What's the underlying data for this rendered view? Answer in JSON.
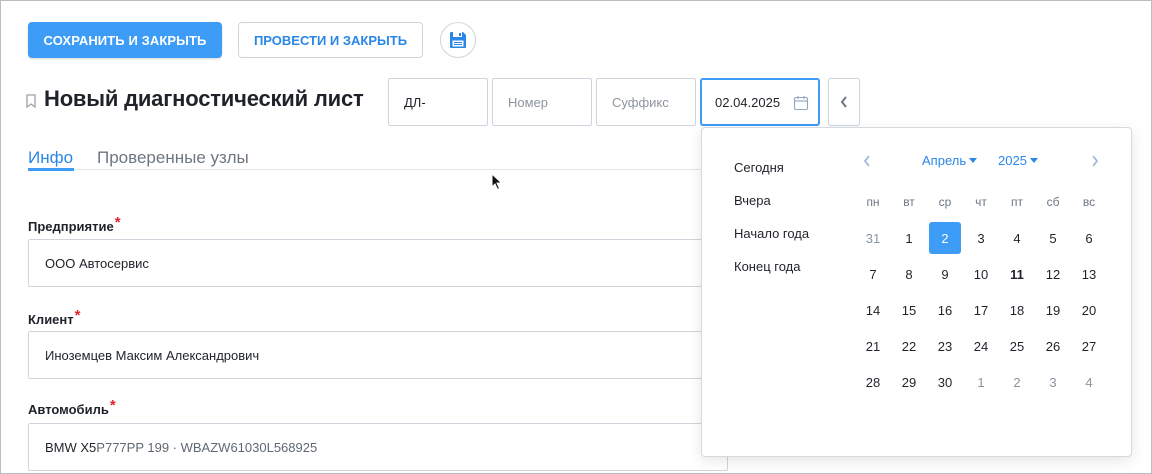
{
  "toolbar": {
    "save_close_label": "СОХРАНИТЬ И ЗАКРЫТЬ",
    "post_close_label": "ПРОВЕСТИ И ЗАКРЫТЬ",
    "save_icon": "floppy-disk-icon"
  },
  "header": {
    "title": "Новый диагностический лист",
    "prefix_value": "ДЛ-",
    "number_placeholder": "Номер",
    "suffix_placeholder": "Суффикс",
    "date_value": "02.04.2025"
  },
  "tabs": [
    {
      "label": "Инфо",
      "active": true
    },
    {
      "label": "Проверенные узлы",
      "active": false
    }
  ],
  "form": {
    "company_label": "Предприятие",
    "company_value": "ООО Автосервис",
    "client_label": "Клиент",
    "client_value": "Иноземцев Максим Александрович",
    "car_label": "Автомобиль",
    "car_model": "BMW X5",
    "car_details": " P777PP 199 · WBAZW61030L568925",
    "required_mark": "*"
  },
  "datepicker": {
    "quick_items": [
      "Сегодня",
      "Вчера",
      "Начало года",
      "Конец года"
    ],
    "month": "Апрель",
    "year": "2025",
    "weekdays": [
      "пн",
      "вт",
      "ср",
      "чт",
      "пт",
      "сб",
      "вс"
    ],
    "weeks": [
      [
        "31",
        "1",
        "2",
        "3",
        "4",
        "5",
        "6"
      ],
      [
        "7",
        "8",
        "9",
        "10",
        "11",
        "12",
        "13"
      ],
      [
        "14",
        "15",
        "16",
        "17",
        "18",
        "19",
        "20"
      ],
      [
        "21",
        "22",
        "23",
        "24",
        "25",
        "26",
        "27"
      ],
      [
        "28",
        "29",
        "30",
        "1",
        "2",
        "3",
        "4"
      ]
    ],
    "selected": "2",
    "today": "11"
  },
  "colors": {
    "accent": "#3d9cf5",
    "link": "#2a87e6",
    "required": "#e0232a"
  }
}
